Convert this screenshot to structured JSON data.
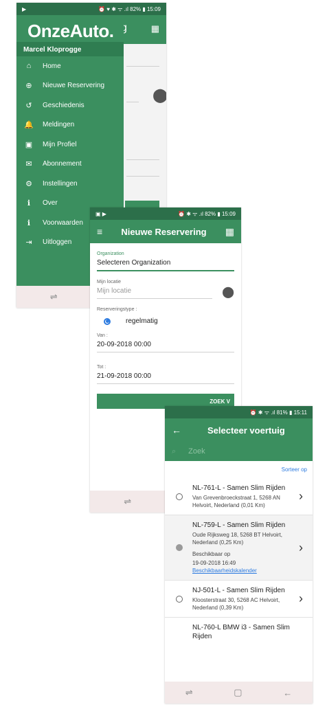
{
  "screen1": {
    "status_left": "▶",
    "status_right": "⏰ ♥ ✱ ᯤ .ıl 82% ▮ 15:09",
    "logo": "OnzeAuto.",
    "username": "Marcel Kloprogge",
    "menu": [
      {
        "icon": "home-icon",
        "glyph": "⌂",
        "label": "Home"
      },
      {
        "icon": "plus-circle-icon",
        "glyph": "⊕",
        "label": "Nieuwe Reservering"
      },
      {
        "icon": "history-icon",
        "glyph": "↺",
        "label": "Geschiedenis"
      },
      {
        "icon": "bell-icon",
        "glyph": "🔔",
        "label": "Meldingen"
      },
      {
        "icon": "profile-card-icon",
        "glyph": "▣",
        "label": "Mijn Profiel"
      },
      {
        "icon": "mail-icon",
        "glyph": "✉",
        "label": "Abonnement"
      },
      {
        "icon": "gear-icon",
        "glyph": "⚙",
        "label": "Instellingen"
      },
      {
        "icon": "info-icon",
        "glyph": "ℹ",
        "label": "Over"
      },
      {
        "icon": "info-icon",
        "glyph": "ℹ",
        "label": "Voorwaarden"
      },
      {
        "icon": "logout-icon",
        "glyph": "⇥",
        "label": "Uitloggen"
      }
    ]
  },
  "screen2": {
    "status_left": "▣ ▶",
    "status_right": "⏰ ✱ ᯤ .ıl 82% ▮ 15:09",
    "title": "Nieuwe Reservering",
    "org_label": "Organization",
    "org_value": "Selecteren Organization",
    "loc_label": "Mijn locatie",
    "loc_placeholder": "Mijn locatie",
    "type_label": "Reserveringstype :",
    "type_value": "regelmatig",
    "from_label": "Van :",
    "from_value": "20-09-2018 00:00",
    "to_label": "Tot :",
    "to_value": "21-09-2018 00:00",
    "search_button": "ZOEK V"
  },
  "screen3": {
    "status_right": "⏰ ✱ ᯤ .ıl 81% ▮ 15:11",
    "title": "Selecteer voertuig",
    "search_placeholder": "Zoek",
    "sort_label": "Sorteer op",
    "vehicles": [
      {
        "title": "NL-761-L - Samen Slim Rijden",
        "address": "Van Grevenbroeckstraat 1, 5268 AN Helvoirt, Nederland (0,01 Km)",
        "selected": false,
        "availability": "",
        "availability_date": "",
        "link": ""
      },
      {
        "title": "NL-759-L - Samen Slim Rijden",
        "address": "Oude Rijksweg 18, 5268 BT Helvoirt, Nederland (0,25 Km)",
        "selected": true,
        "availability": "Beschikbaar op",
        "availability_date": "19-09-2018 16:49",
        "link": "Beschikbaarheidskalender"
      },
      {
        "title": "NJ-501-L - Samen Slim Rijden",
        "address": "Kloosterstraat 30, 5268 AC Helvoirt, Nederland (0,39 Km)",
        "selected": false,
        "availability": "",
        "availability_date": "",
        "link": ""
      },
      {
        "title": "NL-760-L BMW i3 - Samen Slim Rijden",
        "address": "",
        "selected": false,
        "availability": "",
        "availability_date": "",
        "link": ""
      }
    ]
  },
  "navbar": {
    "recent": "⇌",
    "home": "▢",
    "back": "←"
  }
}
